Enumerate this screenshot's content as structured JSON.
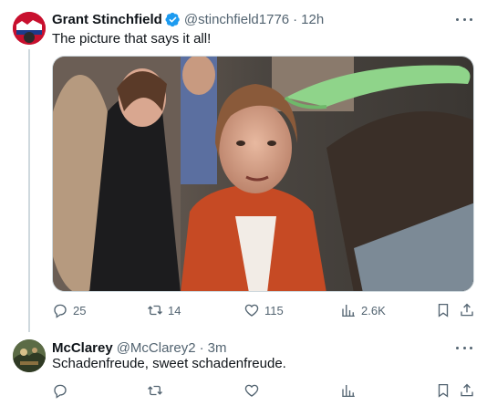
{
  "tweets": [
    {
      "author": "Grant Stinchfield",
      "handle": "@stinchfield1776",
      "time": "12h",
      "text": "The picture that says it all!",
      "verified": true,
      "avatar_icon": "user-avatar-logo",
      "stats": {
        "replies": "25",
        "retweets": "14",
        "likes": "115",
        "views": "2.6K"
      }
    },
    {
      "author": "McClarey",
      "handle": "@McClarey2",
      "time": "3m",
      "text": "Schadenfreude, sweet schadenfreude.",
      "verified": false,
      "avatar_icon": "user-avatar-photo",
      "stats": {
        "replies": "",
        "retweets": "",
        "likes": "",
        "views": ""
      }
    }
  ],
  "separator": "·",
  "colors": {
    "text": "#0f1419",
    "muted": "#536471",
    "verified": "#1d9bf0",
    "border": "#cfd9de"
  }
}
